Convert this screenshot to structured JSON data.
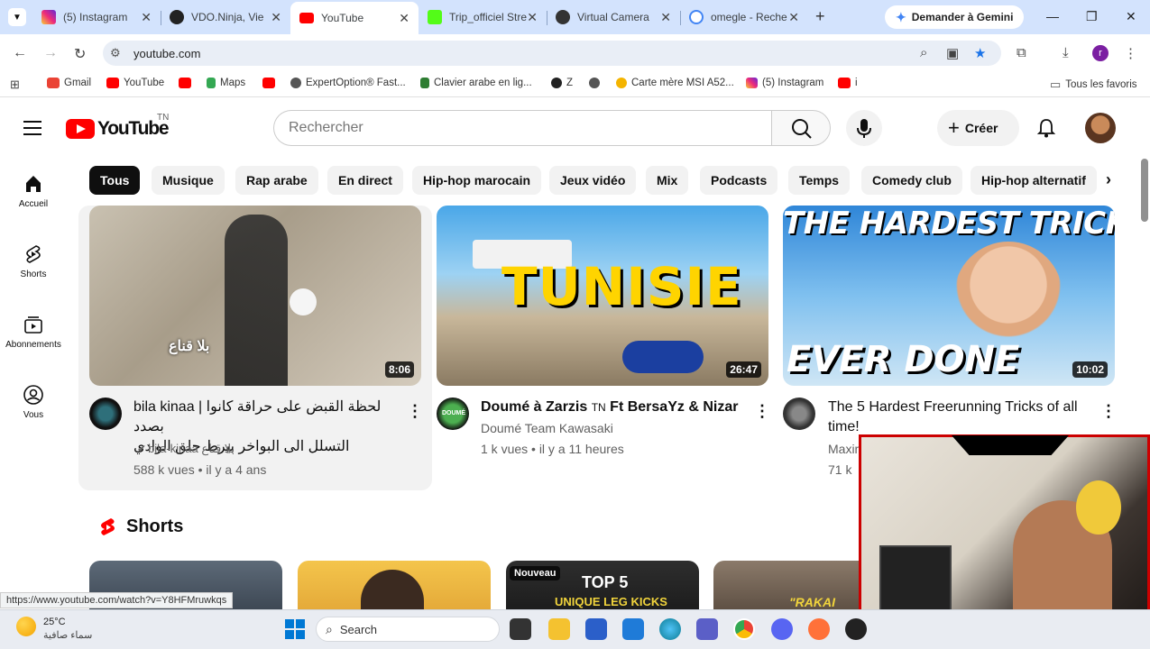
{
  "browser": {
    "tabs": [
      {
        "label": "(5) Instagram",
        "color": "#e1306c"
      },
      {
        "label": "VDO.Ninja, Vie",
        "color": "#222222"
      },
      {
        "label": "YouTube",
        "color": "#ff0000"
      },
      {
        "label": "Trip_officiel Stre",
        "color": "#53fc18"
      },
      {
        "label": "Virtual Camera",
        "color": "#333333"
      },
      {
        "label": "omegle - Reche",
        "color": "#4285f4"
      }
    ],
    "active_tab_index": 2,
    "gemini_label": "Demander à Gemini",
    "url": "youtube.com",
    "bookmarks": [
      {
        "label": "Gmail",
        "color": "#ea4335"
      },
      {
        "label": "YouTube",
        "color": "#ff0000"
      },
      {
        "label": "",
        "color": "#ff0000"
      },
      {
        "label": "Maps",
        "color": "#34a853"
      },
      {
        "label": "",
        "color": "#ff0000"
      },
      {
        "label": "ExpertOption® Fast...",
        "color": "#555555"
      },
      {
        "label": "Clavier arabe en lig...",
        "color": "#2e7d32"
      },
      {
        "label": "Z",
        "color": "#222222"
      },
      {
        "label": "",
        "color": "#555555"
      },
      {
        "label": "Carte mère MSI A52...",
        "color": "#f4b400"
      },
      {
        "label": "(5) Instagram",
        "color": "#e1306c"
      },
      {
        "label": "i",
        "color": "#ff0000"
      }
    ],
    "all_favorites_label": "Tous les favoris"
  },
  "yt": {
    "logo_text": "YouTube",
    "country_code": "TN",
    "search_placeholder": "Rechercher",
    "create_label": "Créer",
    "chips": [
      "Tous",
      "Musique",
      "Rap arabe",
      "En direct",
      "Hip-hop marocain",
      "Jeux vidéo",
      "Mix",
      "Podcasts",
      "Temps",
      "Comedy club",
      "Hip-hop alternatif"
    ],
    "guide": [
      {
        "label": "Accueil",
        "icon": "home-icon"
      },
      {
        "label": "Shorts",
        "icon": "shorts-icon"
      },
      {
        "label": "Abonnements",
        "icon": "subscriptions-icon"
      },
      {
        "label": "Vous",
        "icon": "you-icon"
      }
    ],
    "videos": [
      {
        "title_line1": "bila kinaa | لحظة القبض على حراقة كانوا بصدد",
        "title_line2": "التسلل الى البواخر بيرط حلق الوادي",
        "channel": "bila-kinaa بلا قناع",
        "meta": "588 k vues • il y a 4 ans",
        "duration": "8:06",
        "thumb_text": "بلا قناع"
      },
      {
        "title_line1": "Doumé à Zarzis",
        "title_badge": "TN",
        "title_tail": "Ft BersaYz & Nizar",
        "channel": "Doumé Team Kawasaki",
        "meta": "1 k vues • il y a 11 heures",
        "duration": "26:47",
        "thumb_text": "TUNISIE"
      },
      {
        "title_line1": "The 5 Hardest Freerunning Tricks of all",
        "title_line2": "time!",
        "channel": "Maxim'ss Ward",
        "meta": "71 k",
        "duration": "10:02",
        "thumb_text_top": "THE HARDEST TRICKS",
        "thumb_text_bottom": "EVER DONE"
      }
    ],
    "shorts_heading": "Shorts",
    "shorts": [
      {
        "badge": "",
        "text": ""
      },
      {
        "badge": "",
        "text": ""
      },
      {
        "badge": "Nouveau",
        "text": "TOP 5"
      },
      {
        "badge": "",
        "text": "\"RAKAI"
      }
    ]
  },
  "status_url": "https://www.youtube.com/watch?v=Y8HFMruwkqs",
  "taskbar": {
    "temperature": "25°C",
    "weather": "سماء صافية",
    "search_label": "Search"
  }
}
